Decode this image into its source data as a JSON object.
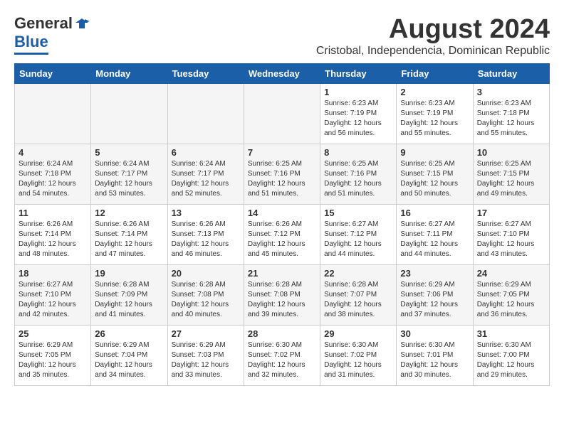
{
  "header": {
    "logo_general": "General",
    "logo_blue": "Blue",
    "month_title": "August 2024",
    "subtitle": "Cristobal, Independencia, Dominican Republic"
  },
  "days_of_week": [
    "Sunday",
    "Monday",
    "Tuesday",
    "Wednesday",
    "Thursday",
    "Friday",
    "Saturday"
  ],
  "weeks": [
    [
      {
        "day": "",
        "info": ""
      },
      {
        "day": "",
        "info": ""
      },
      {
        "day": "",
        "info": ""
      },
      {
        "day": "",
        "info": ""
      },
      {
        "day": "1",
        "info": "Sunrise: 6:23 AM\nSunset: 7:19 PM\nDaylight: 12 hours\nand 56 minutes."
      },
      {
        "day": "2",
        "info": "Sunrise: 6:23 AM\nSunset: 7:19 PM\nDaylight: 12 hours\nand 55 minutes."
      },
      {
        "day": "3",
        "info": "Sunrise: 6:23 AM\nSunset: 7:18 PM\nDaylight: 12 hours\nand 55 minutes."
      }
    ],
    [
      {
        "day": "4",
        "info": "Sunrise: 6:24 AM\nSunset: 7:18 PM\nDaylight: 12 hours\nand 54 minutes."
      },
      {
        "day": "5",
        "info": "Sunrise: 6:24 AM\nSunset: 7:17 PM\nDaylight: 12 hours\nand 53 minutes."
      },
      {
        "day": "6",
        "info": "Sunrise: 6:24 AM\nSunset: 7:17 PM\nDaylight: 12 hours\nand 52 minutes."
      },
      {
        "day": "7",
        "info": "Sunrise: 6:25 AM\nSunset: 7:16 PM\nDaylight: 12 hours\nand 51 minutes."
      },
      {
        "day": "8",
        "info": "Sunrise: 6:25 AM\nSunset: 7:16 PM\nDaylight: 12 hours\nand 51 minutes."
      },
      {
        "day": "9",
        "info": "Sunrise: 6:25 AM\nSunset: 7:15 PM\nDaylight: 12 hours\nand 50 minutes."
      },
      {
        "day": "10",
        "info": "Sunrise: 6:25 AM\nSunset: 7:15 PM\nDaylight: 12 hours\nand 49 minutes."
      }
    ],
    [
      {
        "day": "11",
        "info": "Sunrise: 6:26 AM\nSunset: 7:14 PM\nDaylight: 12 hours\nand 48 minutes."
      },
      {
        "day": "12",
        "info": "Sunrise: 6:26 AM\nSunset: 7:14 PM\nDaylight: 12 hours\nand 47 minutes."
      },
      {
        "day": "13",
        "info": "Sunrise: 6:26 AM\nSunset: 7:13 PM\nDaylight: 12 hours\nand 46 minutes."
      },
      {
        "day": "14",
        "info": "Sunrise: 6:26 AM\nSunset: 7:12 PM\nDaylight: 12 hours\nand 45 minutes."
      },
      {
        "day": "15",
        "info": "Sunrise: 6:27 AM\nSunset: 7:12 PM\nDaylight: 12 hours\nand 44 minutes."
      },
      {
        "day": "16",
        "info": "Sunrise: 6:27 AM\nSunset: 7:11 PM\nDaylight: 12 hours\nand 44 minutes."
      },
      {
        "day": "17",
        "info": "Sunrise: 6:27 AM\nSunset: 7:10 PM\nDaylight: 12 hours\nand 43 minutes."
      }
    ],
    [
      {
        "day": "18",
        "info": "Sunrise: 6:27 AM\nSunset: 7:10 PM\nDaylight: 12 hours\nand 42 minutes."
      },
      {
        "day": "19",
        "info": "Sunrise: 6:28 AM\nSunset: 7:09 PM\nDaylight: 12 hours\nand 41 minutes."
      },
      {
        "day": "20",
        "info": "Sunrise: 6:28 AM\nSunset: 7:08 PM\nDaylight: 12 hours\nand 40 minutes."
      },
      {
        "day": "21",
        "info": "Sunrise: 6:28 AM\nSunset: 7:08 PM\nDaylight: 12 hours\nand 39 minutes."
      },
      {
        "day": "22",
        "info": "Sunrise: 6:28 AM\nSunset: 7:07 PM\nDaylight: 12 hours\nand 38 minutes."
      },
      {
        "day": "23",
        "info": "Sunrise: 6:29 AM\nSunset: 7:06 PM\nDaylight: 12 hours\nand 37 minutes."
      },
      {
        "day": "24",
        "info": "Sunrise: 6:29 AM\nSunset: 7:05 PM\nDaylight: 12 hours\nand 36 minutes."
      }
    ],
    [
      {
        "day": "25",
        "info": "Sunrise: 6:29 AM\nSunset: 7:05 PM\nDaylight: 12 hours\nand 35 minutes."
      },
      {
        "day": "26",
        "info": "Sunrise: 6:29 AM\nSunset: 7:04 PM\nDaylight: 12 hours\nand 34 minutes."
      },
      {
        "day": "27",
        "info": "Sunrise: 6:29 AM\nSunset: 7:03 PM\nDaylight: 12 hours\nand 33 minutes."
      },
      {
        "day": "28",
        "info": "Sunrise: 6:30 AM\nSunset: 7:02 PM\nDaylight: 12 hours\nand 32 minutes."
      },
      {
        "day": "29",
        "info": "Sunrise: 6:30 AM\nSunset: 7:02 PM\nDaylight: 12 hours\nand 31 minutes."
      },
      {
        "day": "30",
        "info": "Sunrise: 6:30 AM\nSunset: 7:01 PM\nDaylight: 12 hours\nand 30 minutes."
      },
      {
        "day": "31",
        "info": "Sunrise: 6:30 AM\nSunset: 7:00 PM\nDaylight: 12 hours\nand 29 minutes."
      }
    ]
  ]
}
